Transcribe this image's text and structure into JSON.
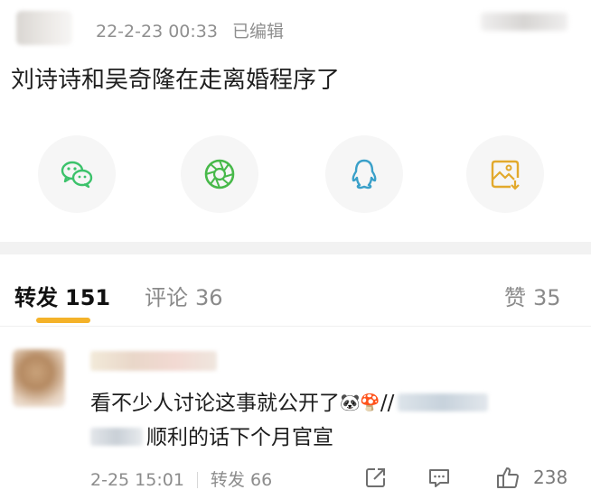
{
  "post": {
    "timestamp": "22-2-23 00:33",
    "edited_label": "已编辑",
    "text": "刘诗诗和吴奇隆在走离婚程序了"
  },
  "share": {
    "items": [
      {
        "icon": "wechat-icon",
        "color": "#3cc26b"
      },
      {
        "icon": "moments-icon",
        "color": "#48b94a"
      },
      {
        "icon": "qq-icon",
        "color": "#3aa0c9"
      },
      {
        "icon": "save-image-icon",
        "color": "#e2a92c"
      }
    ]
  },
  "tabs": {
    "repost_label": "转发",
    "repost_count": "151",
    "comment_label": "评论",
    "comment_count": "36",
    "like_label": "赞",
    "like_count": "35",
    "indicator_color": "#f4b229"
  },
  "comment": {
    "text_line1": "看不少人讨论这事就公开了",
    "mention_prefix": "//",
    "text_line2": "顺利的话下个月官宣",
    "time": "2-25 15:01",
    "repost_label": "转发",
    "repost_count": "66",
    "like_count": "238"
  }
}
